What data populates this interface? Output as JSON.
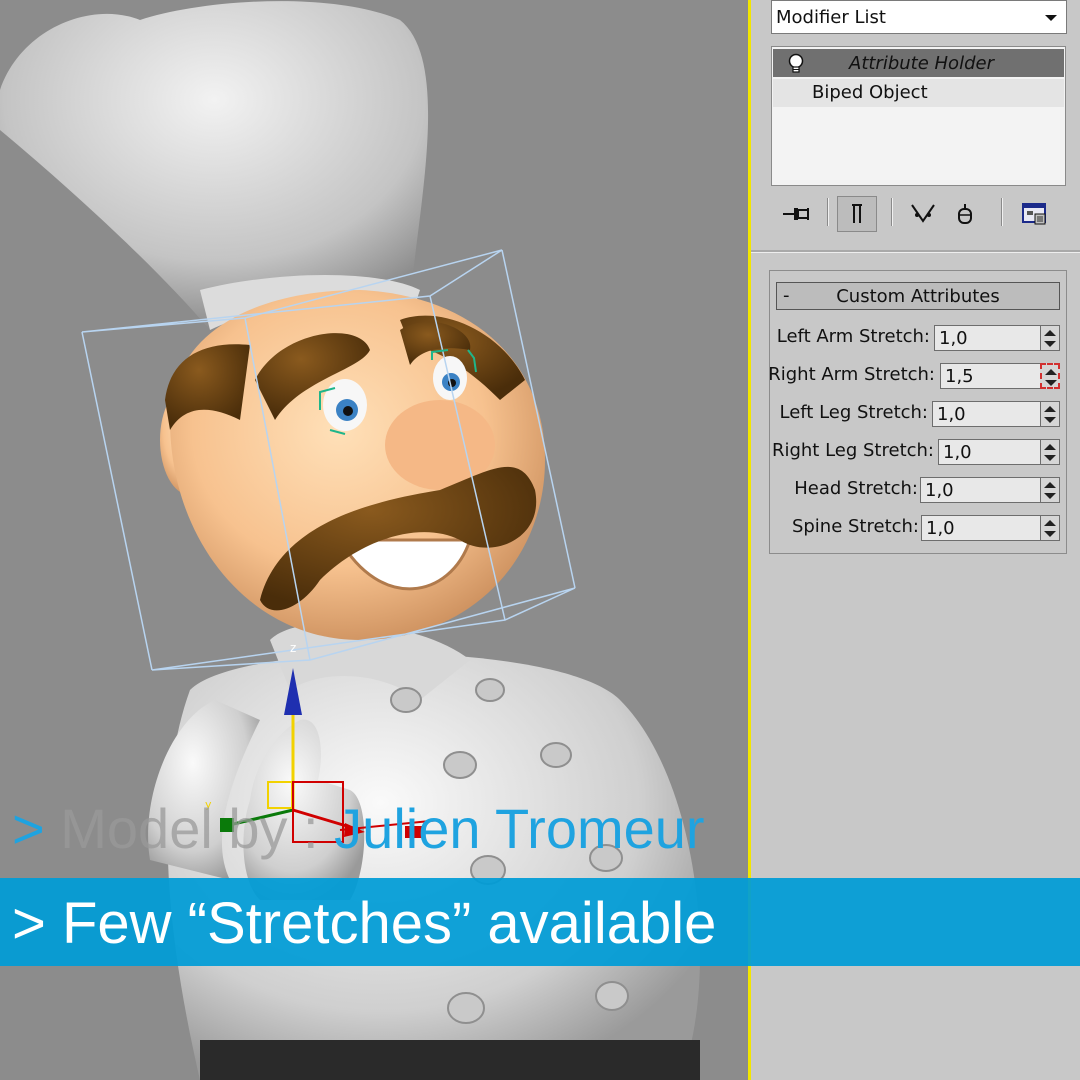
{
  "viewport": {
    "background": "#8c8c8c",
    "gizmo_axis_label": "z",
    "gizmo_axis_label_y": "y"
  },
  "panel": {
    "modifier_list": {
      "label": "Modifier List",
      "icon": "chevron-down-icon"
    },
    "stack": {
      "items": [
        {
          "label": "Attribute Holder",
          "icon": "lightbulb-icon",
          "selected": true
        },
        {
          "label": "Biped Object",
          "selected": false
        }
      ]
    },
    "toolbar": {
      "icons": [
        "pin-stack-icon",
        "show-end-result-icon",
        "make-unique-icon",
        "remove-modifier-icon",
        "configure-modifier-sets-icon"
      ]
    },
    "rollout": {
      "collapse_symbol": "-",
      "title": "Custom Attributes",
      "attributes": [
        {
          "label": "Left Arm Stretch:",
          "value": "1,0"
        },
        {
          "label": "Right Arm Stretch:",
          "value": "1,5"
        },
        {
          "label": "Left Leg Stretch:",
          "value": "1,0"
        },
        {
          "label": "Right Leg Stretch:",
          "value": "1,0"
        },
        {
          "label": "Head Stretch:",
          "value": "1,0"
        },
        {
          "label": "Spine Stretch:",
          "value": "1,0"
        }
      ]
    }
  },
  "caption": {
    "credit_arrow": ">",
    "credit_prefix": " Model by : ",
    "credit_author": "Julien Tromeur",
    "banner": "> Few “Stretches” available"
  },
  "colors": {
    "accent_blue": "#009cd6",
    "viewport_border": "#f2e600",
    "panel_bg": "#c8c8c8"
  }
}
